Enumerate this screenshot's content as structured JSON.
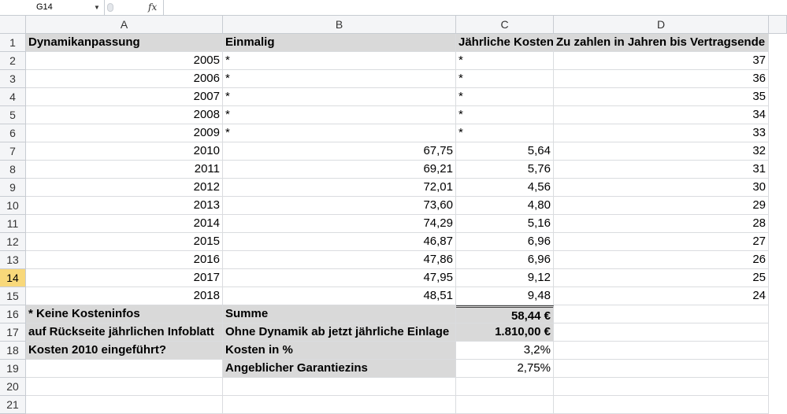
{
  "formula_bar": {
    "name_box": "G14",
    "fx_icon": "fx",
    "formula": ""
  },
  "active_row": "14",
  "column_headers": [
    "A",
    "B",
    "C",
    "D"
  ],
  "row_numbers": [
    "1",
    "2",
    "3",
    "4",
    "5",
    "6",
    "7",
    "8",
    "9",
    "10",
    "11",
    "12",
    "13",
    "14",
    "15",
    "16",
    "17",
    "18",
    "19",
    "20",
    "21"
  ],
  "cells": {
    "header": [
      "Dynamikanpassung",
      "Einmalig",
      "Jährliche Kosten",
      "Zu zahlen in Jahren bis Vertragsende"
    ],
    "years": [
      {
        "A": "2005",
        "B": "*",
        "C": "*",
        "D": "37"
      },
      {
        "A": "2006",
        "B": "*",
        "C": "*",
        "D": "36"
      },
      {
        "A": "2007",
        "B": "*",
        "C": "*",
        "D": "35"
      },
      {
        "A": "2008",
        "B": "*",
        "C": "*",
        "D": "34"
      },
      {
        "A": "2009",
        "B": "*",
        "C": "*",
        "D": "33"
      },
      {
        "A": "2010",
        "B": "67,75",
        "C": "5,64",
        "D": "32"
      },
      {
        "A": "2011",
        "B": "69,21",
        "C": "5,76",
        "D": "31"
      },
      {
        "A": "2012",
        "B": "72,01",
        "C": "4,56",
        "D": "30"
      },
      {
        "A": "2013",
        "B": "73,60",
        "C": "4,80",
        "D": "29"
      },
      {
        "A": "2014",
        "B": "74,29",
        "C": "5,16",
        "D": "28"
      },
      {
        "A": "2015",
        "B": "46,87",
        "C": "6,96",
        "D": "27"
      },
      {
        "A": "2016",
        "B": "47,86",
        "C": "6,96",
        "D": "26"
      },
      {
        "A": "2017",
        "B": "47,95",
        "C": "9,12",
        "D": "25"
      },
      {
        "A": "2018",
        "B": "48,51",
        "C": "9,48",
        "D": "24"
      }
    ],
    "summary": [
      {
        "A": "* Keine Kosteninfos",
        "B": "Summe",
        "C": "58,44 €"
      },
      {
        "A": " auf Rückseite jährlichen Infoblatt",
        "B": "Ohne Dynamik ab jetzt jährliche Einlage",
        "C": "1.810,00 €"
      },
      {
        "A": "Kosten 2010 eingeführt?",
        "B": "Kosten in %",
        "C": "3,2%"
      },
      {
        "A": "",
        "B": "Angeblicher Garantiezins",
        "C": "2,75%"
      }
    ]
  }
}
